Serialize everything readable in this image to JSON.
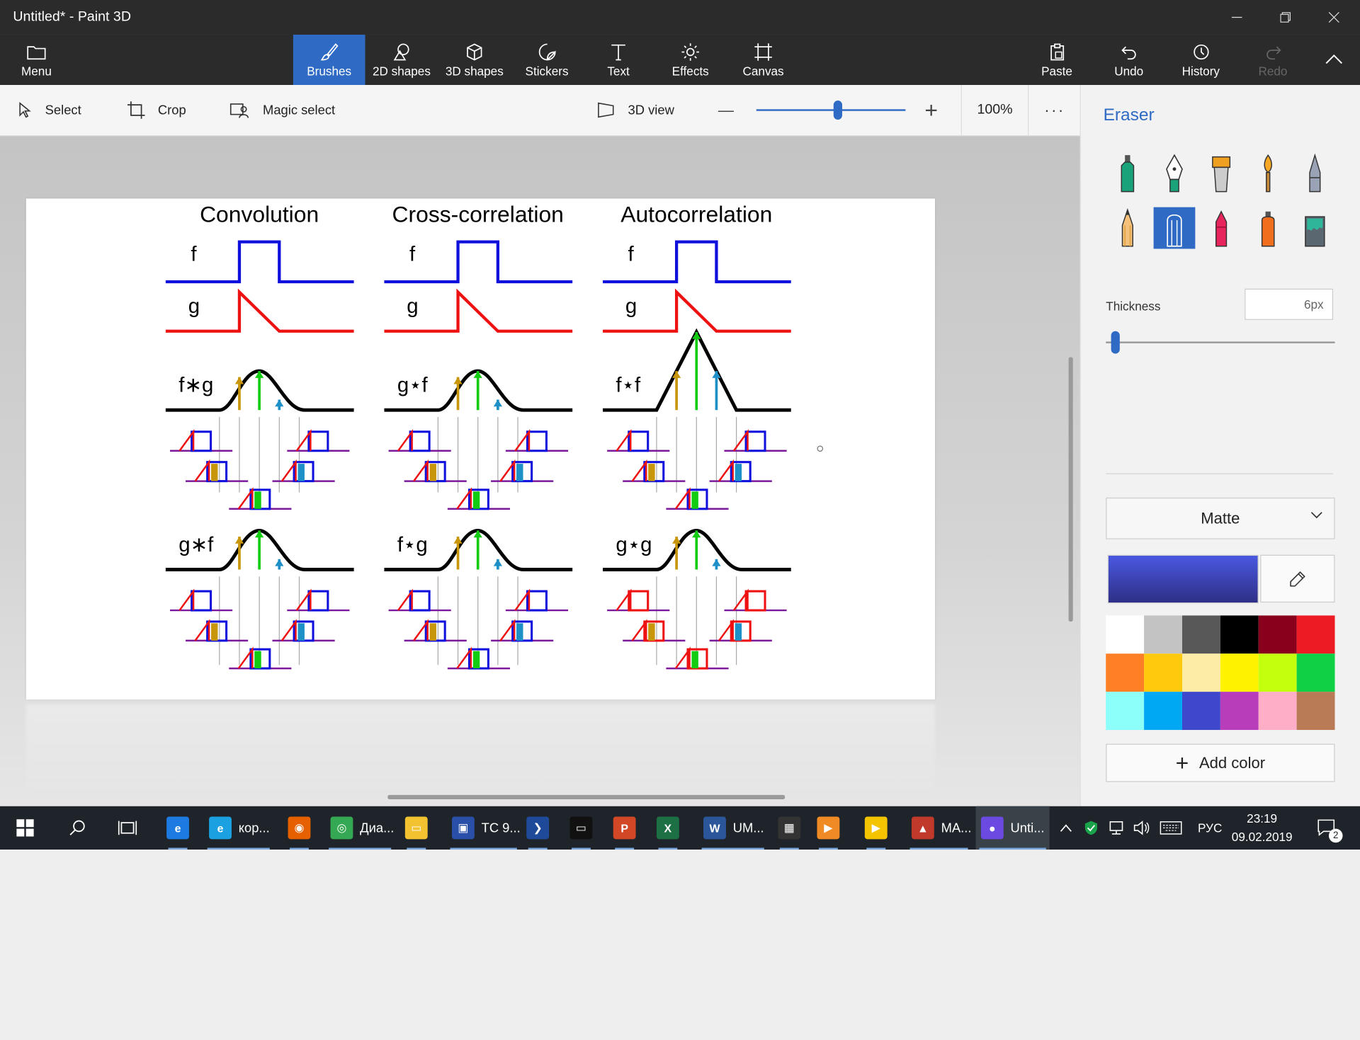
{
  "window": {
    "title": "Untitled* - Paint 3D"
  },
  "ribbon": {
    "menu_label": "Menu",
    "tabs": [
      {
        "label": "Brushes",
        "icon": "brush-icon",
        "active": true
      },
      {
        "label": "2D shapes",
        "icon": "2d-shapes-icon"
      },
      {
        "label": "3D shapes",
        "icon": "cube-icon"
      },
      {
        "label": "Stickers",
        "icon": "sticker-icon"
      },
      {
        "label": "Text",
        "icon": "text-icon"
      },
      {
        "label": "Effects",
        "icon": "sun-icon"
      },
      {
        "label": "Canvas",
        "icon": "canvas-icon"
      }
    ],
    "actions": [
      {
        "label": "Paste",
        "icon": "paste-icon"
      },
      {
        "label": "Undo",
        "icon": "undo-icon"
      },
      {
        "label": "History",
        "icon": "history-icon"
      },
      {
        "label": "Redo",
        "icon": "redo-icon",
        "disabled": true
      }
    ]
  },
  "toolbar": {
    "select_label": "Select",
    "crop_label": "Crop",
    "magic_select_label": "Magic select",
    "view3d_label": "3D view",
    "zoom_minus": "—",
    "zoom_plus": "+",
    "zoom_value": "100%",
    "zoom_fraction": 0.55,
    "more": "···"
  },
  "canvas_image": {
    "column_titles": [
      "Convolution",
      "Cross-correlation",
      "Autocorrelation"
    ],
    "f_label": "f",
    "g_label": "g",
    "row1_labels": [
      "f∗g",
      "g⋆f",
      "f⋆f"
    ],
    "row2_labels": [
      "g∗f",
      "f⋆g",
      "g⋆g"
    ],
    "colors": {
      "f": "#1010dd",
      "g": "#ee1111",
      "result": "#000000",
      "gold": "#c8960a",
      "green": "#11cc11",
      "blue": "#1e90c8",
      "axis": "#7a1a9a"
    }
  },
  "panel": {
    "title": "Eraser",
    "brushes": [
      "marker-icon",
      "calligraphy-pen-icon",
      "oil-brush-icon",
      "watercolor-icon",
      "pixel-pen-icon",
      "pencil-icon",
      "eraser-icon",
      "crayon-icon",
      "spray-can-icon",
      "fill-bucket-icon"
    ],
    "selected_brush": 6,
    "thickness_label": "Thickness",
    "thickness_value": "6px",
    "finish": "Matte",
    "current_color": "#3b43c8",
    "palette": [
      "#ffffff",
      "#c3c3c3",
      "#585858",
      "#000000",
      "#88001b",
      "#ec1c24",
      "#ff7f27",
      "#ffc90e",
      "#fdeca6",
      "#fff200",
      "#c4ff0e",
      "#0ed145",
      "#8cfffb",
      "#00a8f3",
      "#3f48cc",
      "#b83dba",
      "#ffaec8",
      "#b97a56"
    ],
    "add_color_label": "Add color"
  },
  "taskbar": {
    "apps": [
      {
        "label": "",
        "icon": "edge-icon"
      },
      {
        "label": "кор...",
        "icon": "ie-icon"
      },
      {
        "label": "",
        "icon": "firefox-icon"
      },
      {
        "label": "Диа...",
        "icon": "chrome-icon"
      },
      {
        "label": "",
        "icon": "explorer-icon"
      },
      {
        "label": "TC 9...",
        "icon": "total-commander-icon"
      },
      {
        "label": "",
        "icon": "powershell-icon"
      },
      {
        "label": "",
        "icon": "cmd-icon"
      },
      {
        "label": "",
        "icon": "powerpoint-icon"
      },
      {
        "label": "",
        "icon": "excel-icon"
      },
      {
        "label": "UM...",
        "icon": "word-icon"
      },
      {
        "label": "",
        "icon": "calculator-icon"
      },
      {
        "label": "",
        "icon": "media-player-icon"
      },
      {
        "label": "",
        "icon": "player-icon",
        "badge": "Player"
      },
      {
        "label": "MA...",
        "icon": "matlab-icon"
      },
      {
        "label": "Unti...",
        "icon": "paint3d-icon"
      }
    ],
    "language": "РУС",
    "time": "23:19",
    "date": "09.02.2019",
    "notifications": "2"
  }
}
